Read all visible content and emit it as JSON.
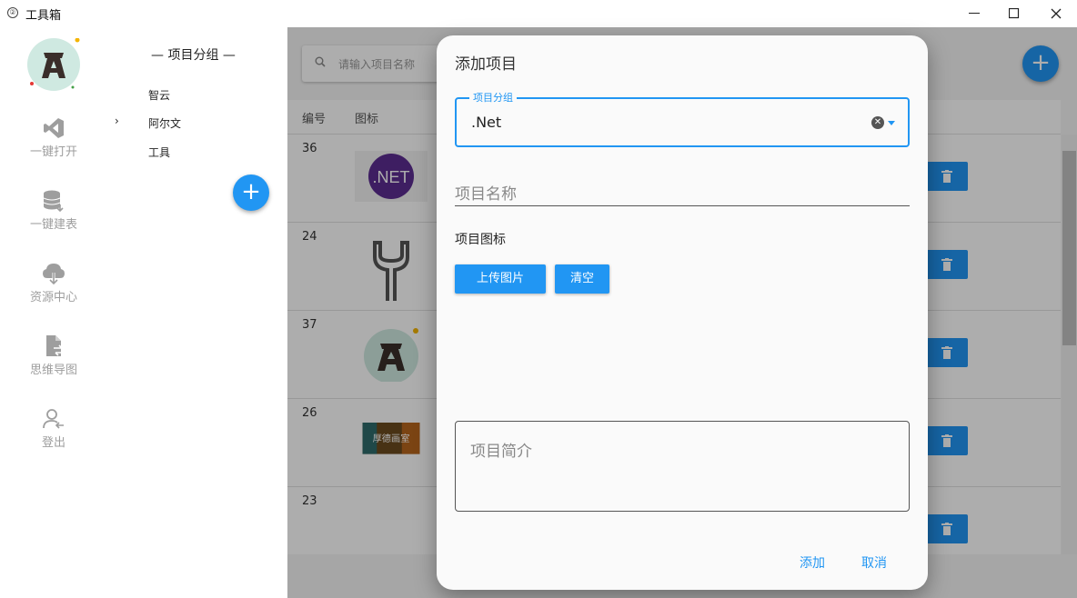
{
  "window": {
    "title": "工具箱",
    "icon_glyph": "②",
    "minimize": "—",
    "maximize": "☐",
    "close": "✕"
  },
  "nav": {
    "items": [
      {
        "label": "一键打开",
        "icon": "vscode-icon"
      },
      {
        "label": "一键建表",
        "icon": "database-icon"
      },
      {
        "label": "资源中心",
        "icon": "cloud-download-icon"
      },
      {
        "label": "思维导图",
        "icon": "file-sync-icon"
      },
      {
        "label": "登出",
        "icon": "logout-user-icon"
      }
    ]
  },
  "groups": {
    "title": "— 项目分组 —",
    "items": [
      "智云",
      "阿尔文",
      "工具"
    ],
    "selected_index": 1,
    "arrow": "›",
    "add": "+"
  },
  "main": {
    "search_placeholder": "请输入项目名称",
    "add": "+",
    "columns": [
      "编号",
      "图标"
    ],
    "rows": [
      {
        "id": "36",
        "thumb": ".NET"
      },
      {
        "id": "24",
        "thumb": "wrench"
      },
      {
        "id": "37",
        "thumb": "avatar"
      },
      {
        "id": "26",
        "thumb": "厚德画室"
      },
      {
        "id": "23",
        "thumb": ""
      }
    ]
  },
  "dialog": {
    "title": "添加项目",
    "group_label": "项目分组",
    "group_value": ".Net",
    "name_placeholder": "项目名称",
    "icon_label": "项目图标",
    "upload_button": "上传图片",
    "clear_button": "清空",
    "description_placeholder": "项目简介",
    "add_button": "添加",
    "cancel_button": "取消"
  },
  "colors": {
    "primary": "#2196f3",
    "muted_text": "#9e9e9e",
    "dotnet_purple": "#5c2d91"
  }
}
